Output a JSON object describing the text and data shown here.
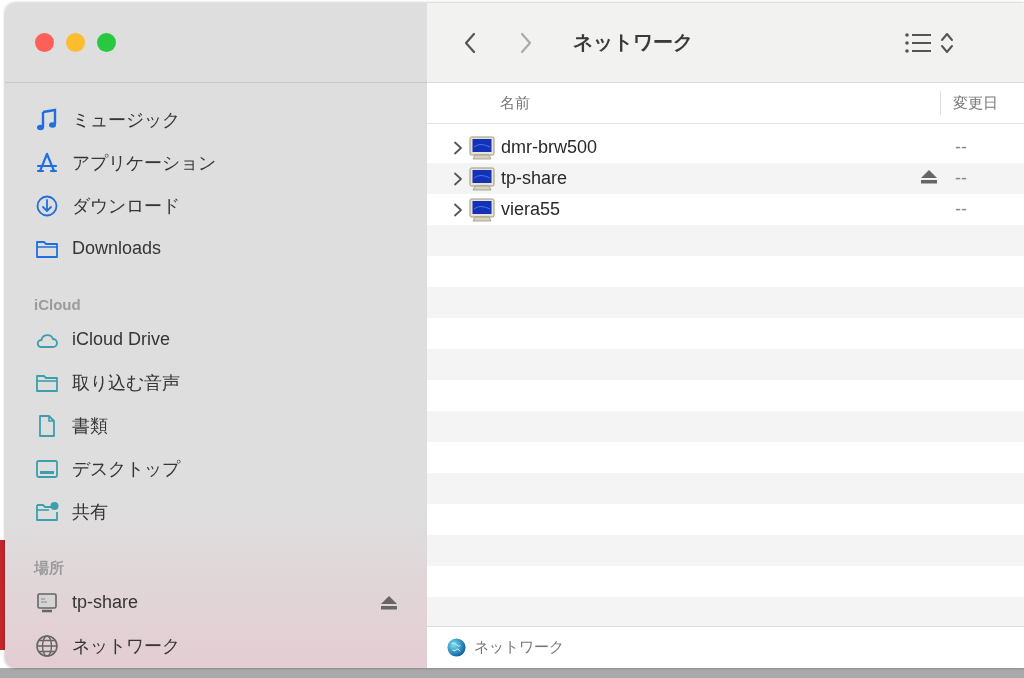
{
  "window": {
    "title": "ネットワーク"
  },
  "toolbar": {
    "back": {
      "disabled": false
    },
    "forward": {
      "disabled": true
    }
  },
  "sidebar": {
    "sections": [
      {
        "items": [
          {
            "label": "ミュージック",
            "kind": "music",
            "selected": false,
            "ejectable": false
          },
          {
            "label": "アプリケーション",
            "kind": "apps",
            "selected": false,
            "ejectable": false
          },
          {
            "label": "ダウンロード",
            "kind": "download",
            "selected": false,
            "ejectable": false
          },
          {
            "label": "Downloads",
            "kind": "folder",
            "selected": false,
            "ejectable": false
          }
        ]
      },
      {
        "header": "iCloud",
        "items": [
          {
            "label": "iCloud Drive",
            "kind": "cloud",
            "selected": false,
            "ejectable": false
          },
          {
            "label": "取り込む音声",
            "kind": "folder",
            "selected": false,
            "ejectable": false
          },
          {
            "label": "書類",
            "kind": "document",
            "selected": false,
            "ejectable": false
          },
          {
            "label": "デスクトップ",
            "kind": "desktop",
            "selected": false,
            "ejectable": false
          },
          {
            "label": "共有",
            "kind": "shared",
            "selected": false,
            "ejectable": false
          }
        ]
      },
      {
        "header": "場所",
        "items": [
          {
            "label": "tp-share",
            "kind": "server",
            "selected": false,
            "ejectable": true
          },
          {
            "label": "ネットワーク",
            "kind": "network",
            "selected": false,
            "ejectable": false
          }
        ]
      }
    ]
  },
  "table": {
    "columns": [
      "名前",
      "変更日"
    ],
    "rows": [
      {
        "name": "dmr-brw500",
        "date": "--",
        "expanded": false,
        "ejectable": false
      },
      {
        "name": "tp-share",
        "date": "--",
        "expanded": false,
        "ejectable": true
      },
      {
        "name": "viera55",
        "date": "--",
        "expanded": false,
        "ejectable": false
      }
    ]
  },
  "status_bar": {
    "path": "ネットワーク"
  }
}
